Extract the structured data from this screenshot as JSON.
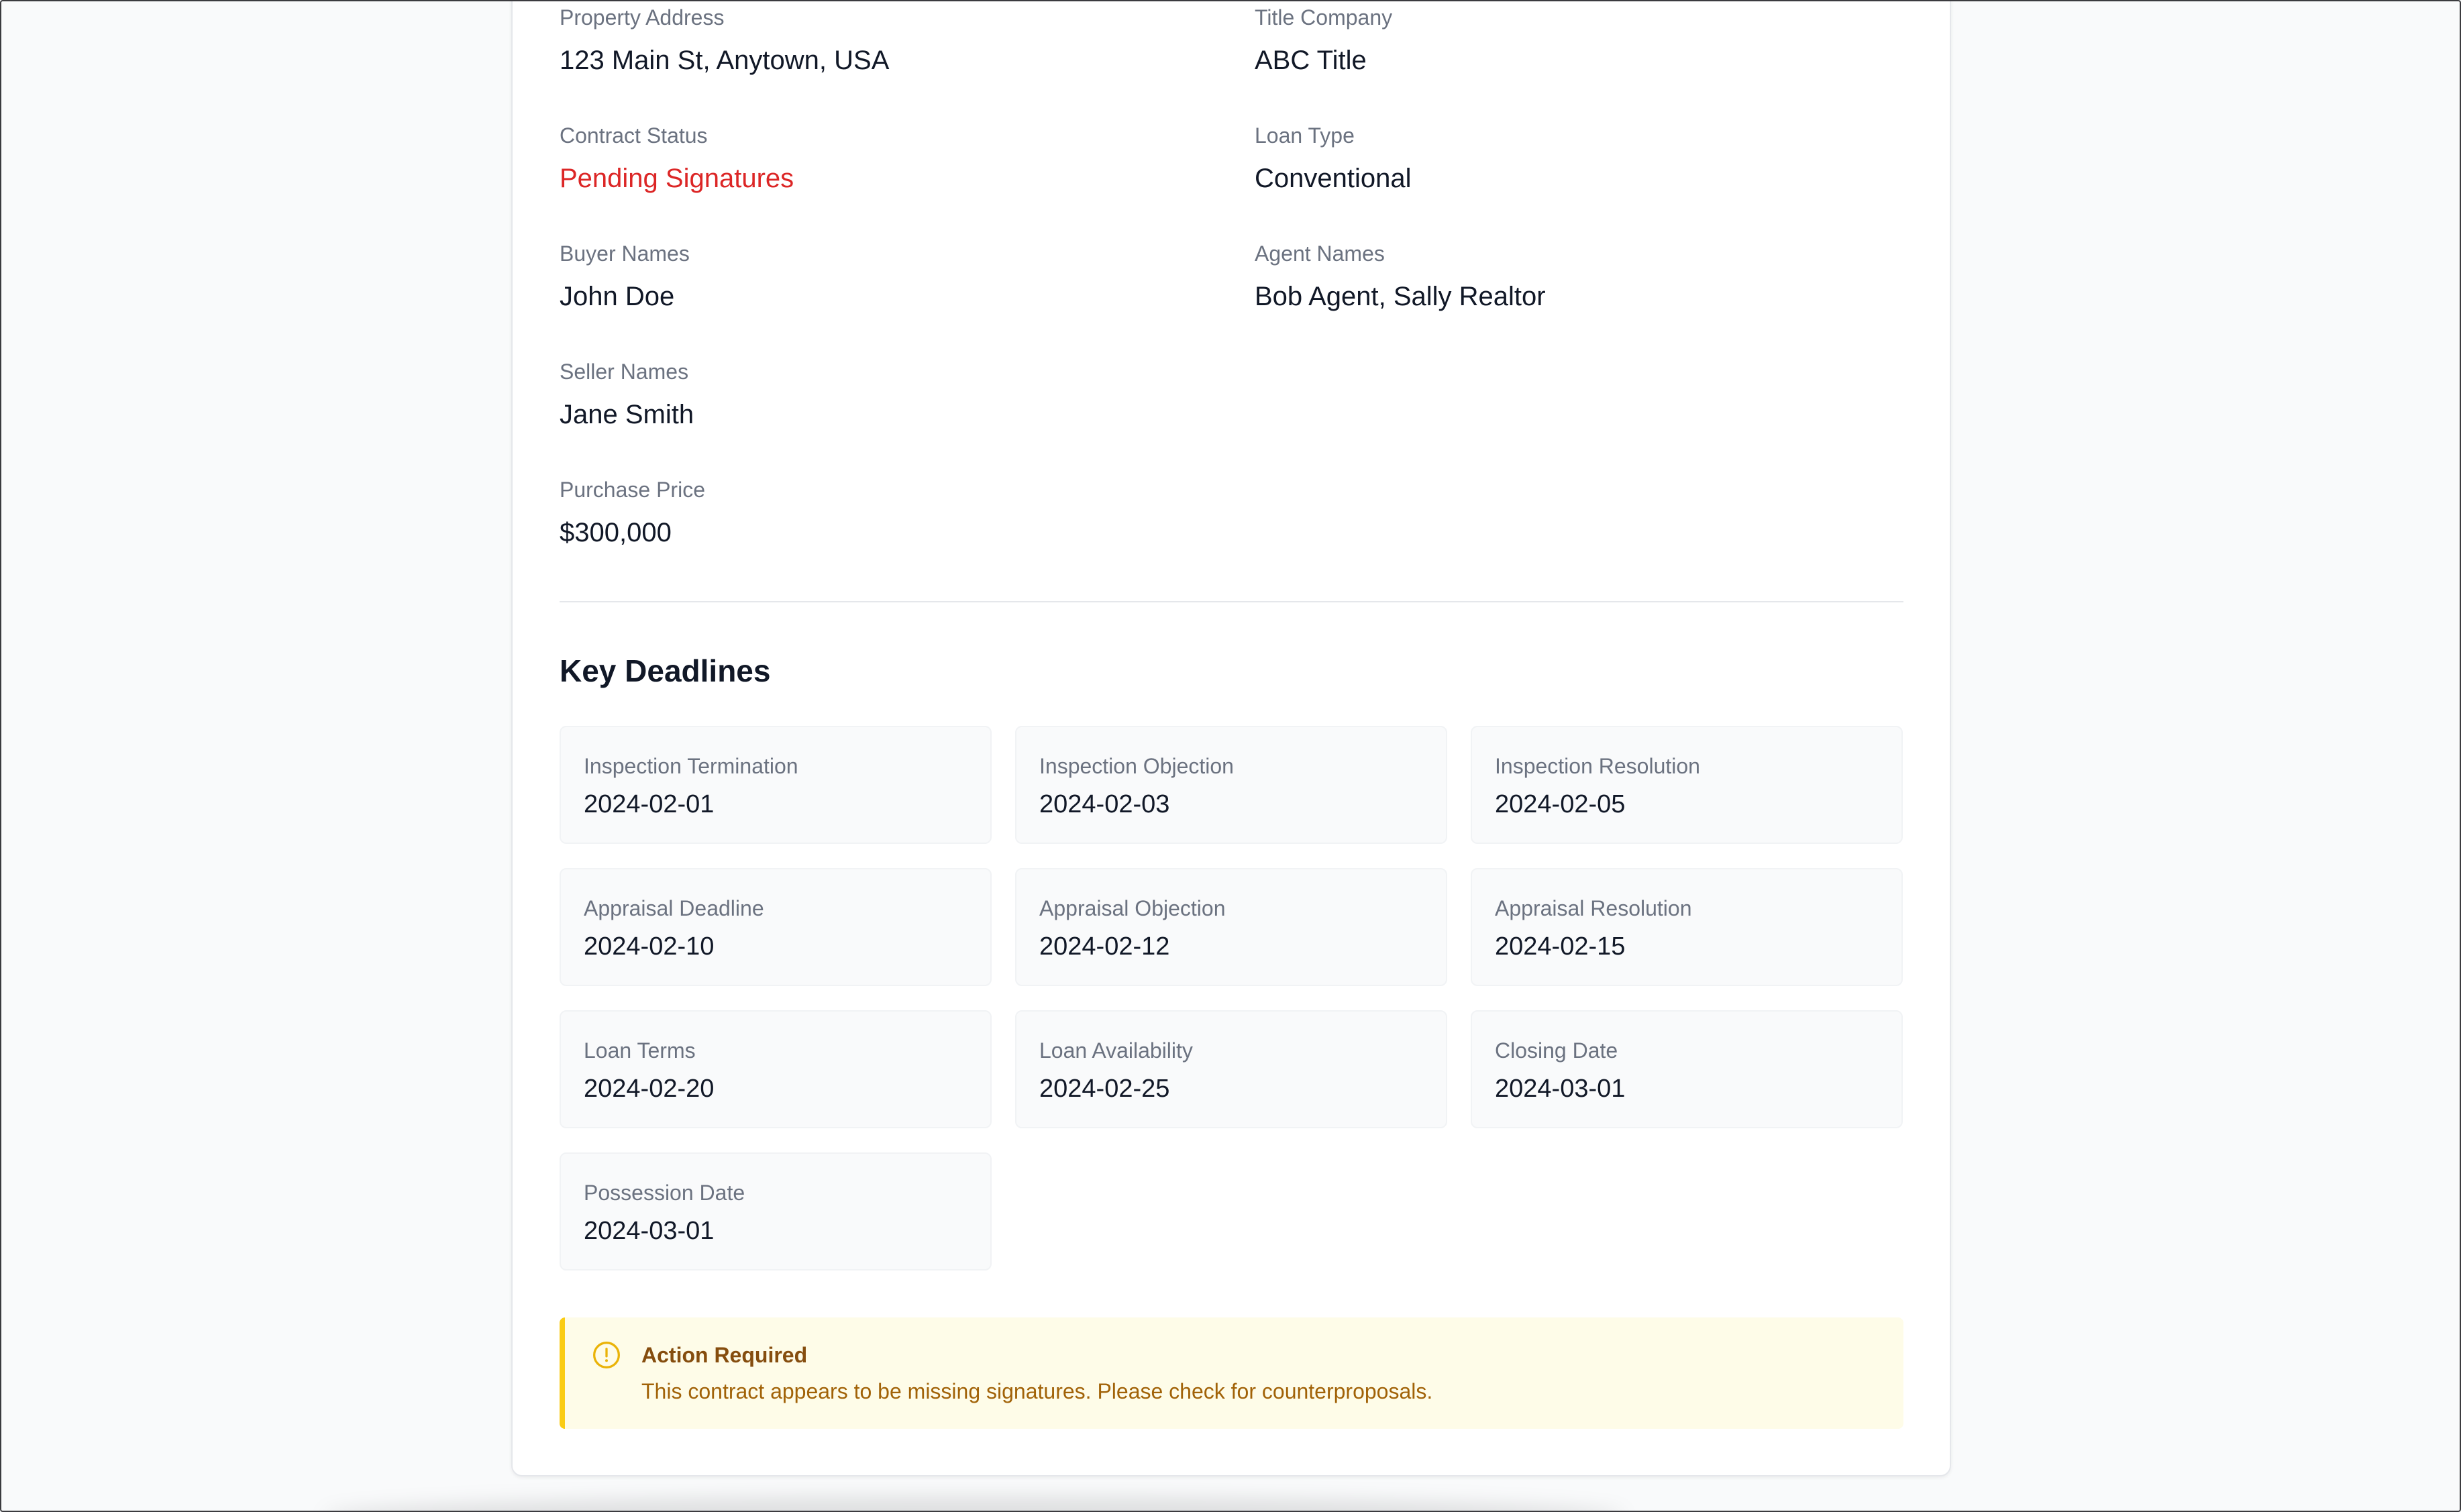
{
  "details": {
    "property_address": {
      "label": "Property Address",
      "value": "123 Main St, Anytown, USA"
    },
    "title_company": {
      "label": "Title Company",
      "value": "ABC Title"
    },
    "contract_status": {
      "label": "Contract Status",
      "value": "Pending Signatures"
    },
    "loan_type": {
      "label": "Loan Type",
      "value": "Conventional"
    },
    "buyer_names": {
      "label": "Buyer Names",
      "value": "John Doe"
    },
    "agent_names": {
      "label": "Agent Names",
      "value": "Bob Agent, Sally Realtor"
    },
    "seller_names": {
      "label": "Seller Names",
      "value": "Jane Smith"
    },
    "purchase_price": {
      "label": "Purchase Price",
      "value": "$300,000"
    }
  },
  "deadlines": {
    "title": "Key Deadlines",
    "items": [
      {
        "label": "Inspection Termination",
        "date": "2024-02-01"
      },
      {
        "label": "Inspection Objection",
        "date": "2024-02-03"
      },
      {
        "label": "Inspection Resolution",
        "date": "2024-02-05"
      },
      {
        "label": "Appraisal Deadline",
        "date": "2024-02-10"
      },
      {
        "label": "Appraisal Objection",
        "date": "2024-02-12"
      },
      {
        "label": "Appraisal Resolution",
        "date": "2024-02-15"
      },
      {
        "label": "Loan Terms",
        "date": "2024-02-20"
      },
      {
        "label": "Loan Availability",
        "date": "2024-02-25"
      },
      {
        "label": "Closing Date",
        "date": "2024-03-01"
      },
      {
        "label": "Possession Date",
        "date": "2024-03-01"
      }
    ]
  },
  "alert": {
    "icon": "alert-circle-icon",
    "title": "Action Required",
    "message": "This contract appears to be missing signatures. Please check for counterproposals."
  },
  "colors": {
    "status_pending": "#dc2626",
    "alert_border": "#facc15",
    "alert_background": "#fefce8"
  }
}
